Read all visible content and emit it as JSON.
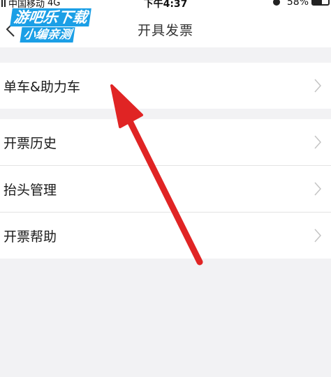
{
  "status_bar": {
    "carrier": "中国移动",
    "network": "4G",
    "time": "下午4:37",
    "battery_percent": "58%",
    "battery_level": 0.58
  },
  "nav": {
    "title": "开具发票",
    "back_icon": "chevron-left-icon"
  },
  "watermark": {
    "line1": "游吧乐下载",
    "line2": "小编亲测"
  },
  "sections": [
    {
      "items": [
        {
          "label": "单车&助力车"
        }
      ]
    },
    {
      "items": [
        {
          "label": "开票历史"
        },
        {
          "label": "抬头管理"
        },
        {
          "label": "开票帮助"
        }
      ]
    }
  ],
  "colors": {
    "background": "#f2f2f4",
    "row_bg": "#ffffff",
    "annotation_arrow": "#e02424",
    "watermark_blue": "#1b9fe6"
  }
}
